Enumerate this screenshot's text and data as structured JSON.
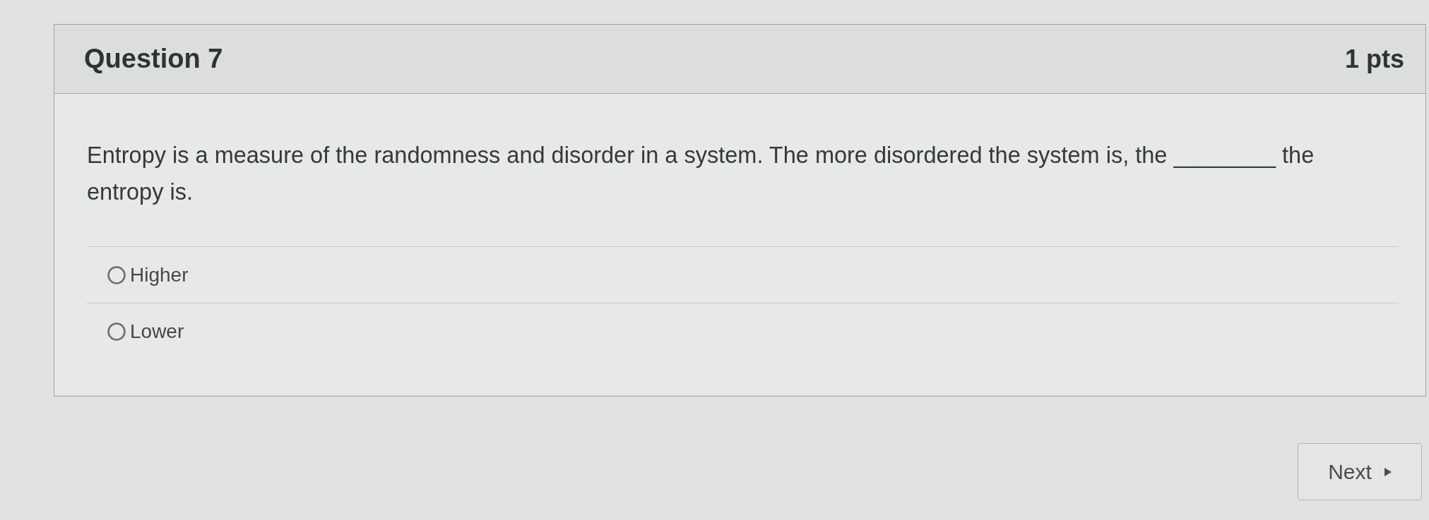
{
  "question": {
    "title": "Question 7",
    "points": "1 pts"
  },
  "prompt": "Entropy is a measure of the randomness and disorder in a system. The more disordered the system is, the ________ the entropy is.",
  "options": [
    {
      "label": "Higher",
      "selected": false
    },
    {
      "label": "Lower",
      "selected": false
    }
  ],
  "next_button": {
    "label": "Next"
  }
}
